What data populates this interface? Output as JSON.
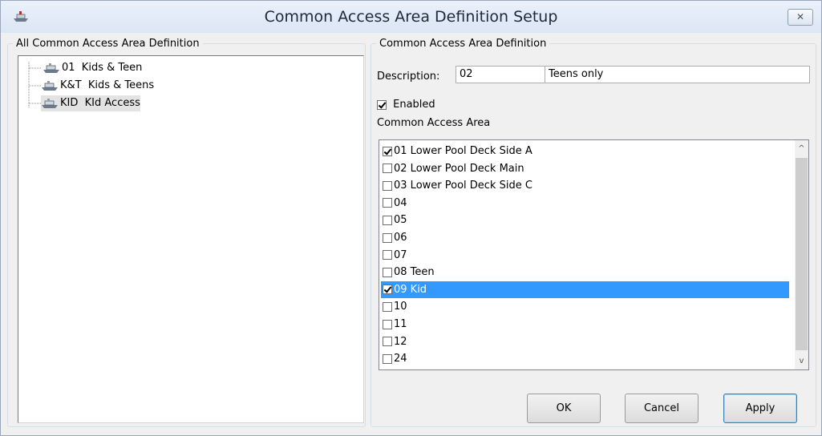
{
  "window": {
    "title": "Common Access Area Definition Setup",
    "close_glyph": "✕"
  },
  "left": {
    "legend": "All Common Access Area Definition",
    "tree": [
      {
        "label": "01  Kids & Teen",
        "selected": false
      },
      {
        "label": "K&T  Kids & Teens",
        "selected": false
      },
      {
        "label": "KID  KId Access",
        "selected": true
      }
    ]
  },
  "right": {
    "legend": "Common Access Area Definition",
    "description_label": "Description:",
    "code_value": "02",
    "description_value": "Teens only",
    "enabled_label": "Enabled",
    "enabled_checked": true,
    "area_label": "Common Access Area",
    "areas": [
      {
        "label": "01 Lower Pool Deck Side A",
        "checked": true,
        "selected": false
      },
      {
        "label": "02 Lower Pool Deck Main",
        "checked": false,
        "selected": false
      },
      {
        "label": "03 Lower Pool Deck Side C",
        "checked": false,
        "selected": false
      },
      {
        "label": "04",
        "checked": false,
        "selected": false
      },
      {
        "label": "05",
        "checked": false,
        "selected": false
      },
      {
        "label": "06",
        "checked": false,
        "selected": false
      },
      {
        "label": "07",
        "checked": false,
        "selected": false
      },
      {
        "label": "08 Teen",
        "checked": false,
        "selected": false
      },
      {
        "label": "09 Kid",
        "checked": true,
        "selected": true
      },
      {
        "label": "10",
        "checked": false,
        "selected": false
      },
      {
        "label": "11",
        "checked": false,
        "selected": false
      },
      {
        "label": "12",
        "checked": false,
        "selected": false
      },
      {
        "label": "24",
        "checked": false,
        "selected": false
      }
    ],
    "scroll_up": "^",
    "scroll_down": "v"
  },
  "buttons": {
    "ok": "OK",
    "cancel": "Cancel",
    "apply": "Apply"
  },
  "icons": {
    "app": "ship-icon",
    "tree_node": "ship-icon",
    "close": "close-icon"
  },
  "colors": {
    "selection": "#3399ff",
    "title_bg": "#dbe6f4"
  }
}
